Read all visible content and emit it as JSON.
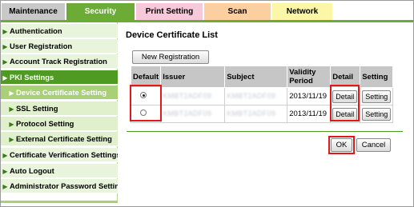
{
  "tabs": [
    {
      "label": "Maintenance"
    },
    {
      "label": "Security"
    },
    {
      "label": "Print Setting"
    },
    {
      "label": "Scan"
    },
    {
      "label": "Network"
    }
  ],
  "sidebar": {
    "items": [
      {
        "label": "Authentication"
      },
      {
        "label": "User Registration"
      },
      {
        "label": "Account Track Registration"
      },
      {
        "label": "PKI Settings"
      },
      {
        "label": "Device Certificate Setting"
      },
      {
        "label": "SSL Setting"
      },
      {
        "label": "Protocol Setting"
      },
      {
        "label": "External Certificate Setting"
      },
      {
        "label": "Certificate Verification Settings"
      },
      {
        "label": "Auto Logout"
      },
      {
        "label": "Administrator Password Setting"
      }
    ]
  },
  "main": {
    "title": "Device Certificate List",
    "new_registration_label": "New Registration",
    "table": {
      "headers": [
        "Default",
        "Issuer",
        "Subject",
        "Validity Period",
        "Detail",
        "Setting"
      ],
      "rows": [
        {
          "default_selected": true,
          "issuer": "KMBT2ADF09",
          "subject": "KMBT2ADF09",
          "validity": "2013/11/19",
          "detail_label": "Detail",
          "setting_label": "Setting"
        },
        {
          "default_selected": false,
          "issuer": "KMBT2ADF09",
          "subject": "KMBT2ADF09",
          "validity": "2013/11/19",
          "detail_label": "Detail",
          "setting_label": "Setting"
        }
      ]
    },
    "ok_label": "OK",
    "cancel_label": "Cancel"
  },
  "colors": {
    "security_tab": "#6cab35",
    "highlight_box": "#e01818",
    "sidebar_active": "#a9cf77"
  }
}
